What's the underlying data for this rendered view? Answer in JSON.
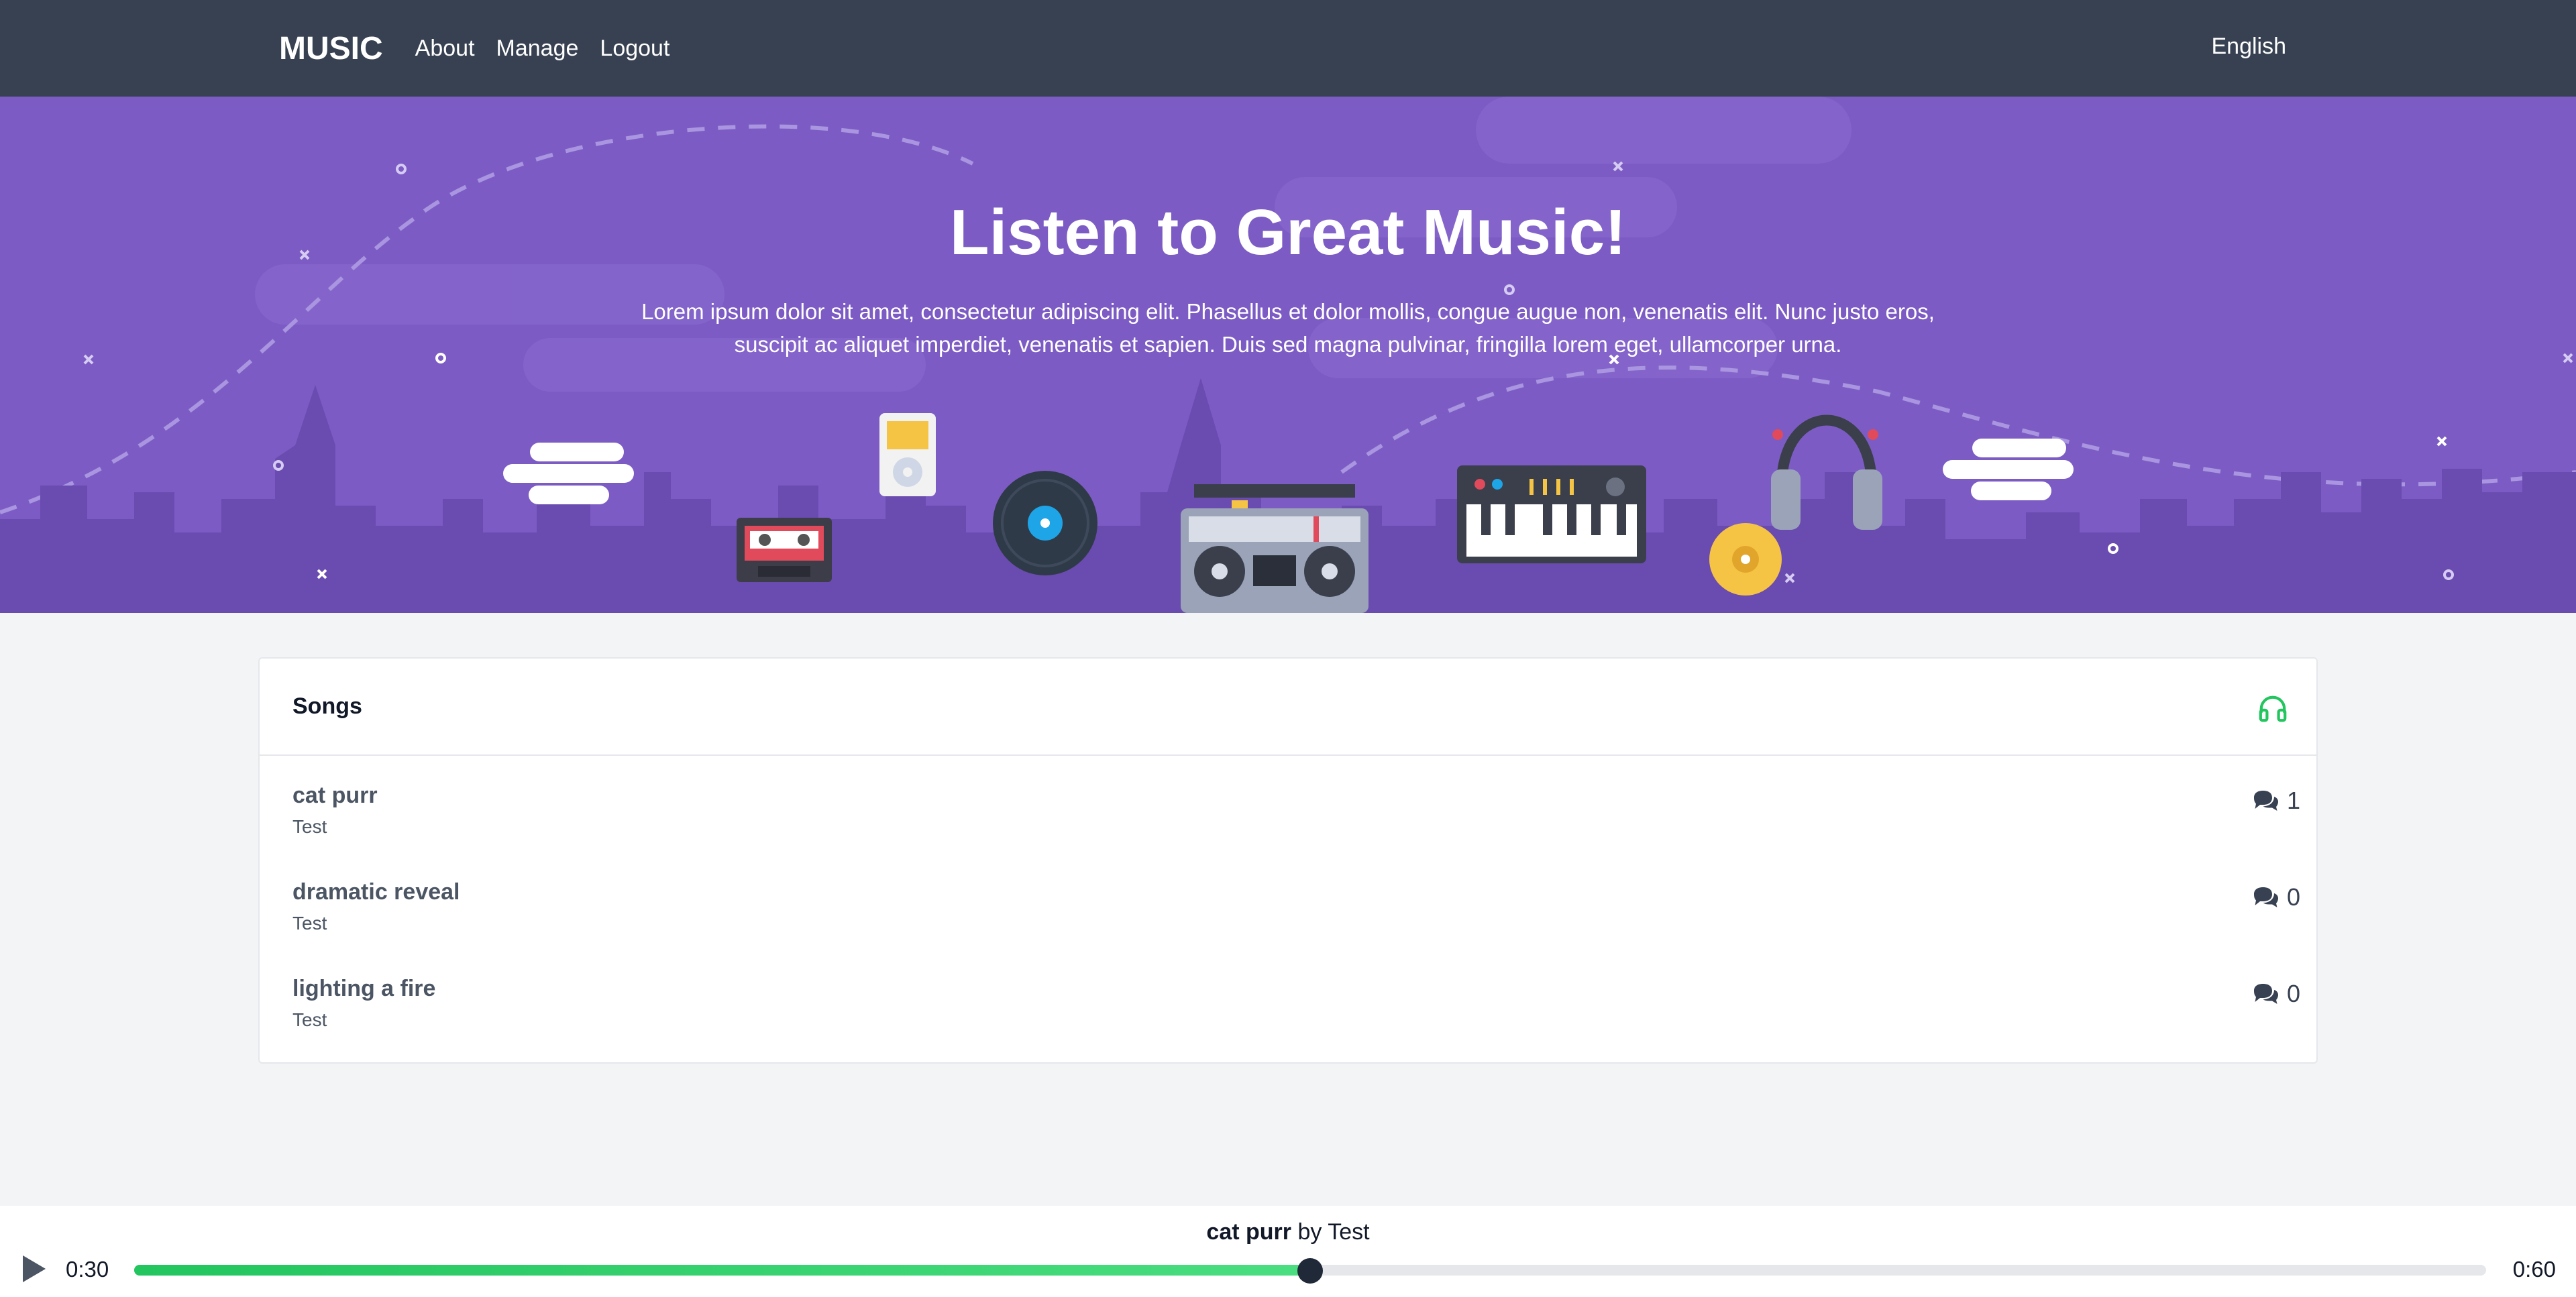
{
  "nav": {
    "brand": "MUSIC",
    "links": [
      "About",
      "Manage",
      "Logout"
    ],
    "language": "English"
  },
  "hero": {
    "title": "Listen to Great Music!",
    "text": "Lorem ipsum dolor sit amet, consectetur adipiscing elit. Phasellus et dolor mollis, congue augue non, venenatis elit. Nunc justo eros, suscipit ac aliquet imperdiet, venenatis et sapien. Duis sed magna pulvinar, fringilla lorem eget, ullamcorper urna."
  },
  "songs": {
    "title": "Songs",
    "header_icon": "headphones-icon",
    "items": [
      {
        "title": "cat purr",
        "artist": "Test",
        "comments": "1"
      },
      {
        "title": "dramatic reveal",
        "artist": "Test",
        "comments": "0"
      },
      {
        "title": "lighting a fire",
        "artist": "Test",
        "comments": "0"
      }
    ]
  },
  "player": {
    "song": "cat purr",
    "by": "by",
    "artist": "Test",
    "current_time": "0:30",
    "duration": "0:60",
    "progress": 0.5
  },
  "colors": {
    "navbar": "#374151",
    "hero": "#7c5cc4",
    "accent_green": "#22c55e"
  }
}
